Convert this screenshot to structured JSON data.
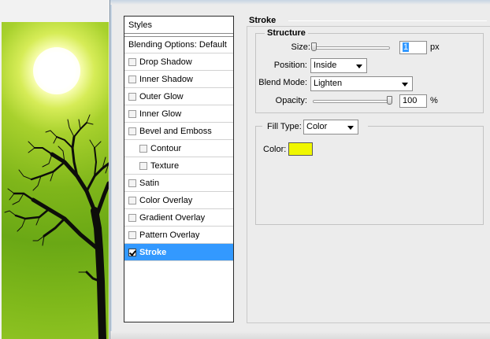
{
  "styles_panel": {
    "header": "Styles",
    "blending_options": "Blending Options: Default",
    "items": [
      {
        "label": "Drop Shadow",
        "checked": false,
        "selected": false
      },
      {
        "label": "Inner Shadow",
        "checked": false,
        "selected": false
      },
      {
        "label": "Outer Glow",
        "checked": false,
        "selected": false
      },
      {
        "label": "Inner Glow",
        "checked": false,
        "selected": false
      },
      {
        "label": "Bevel and Emboss",
        "checked": false,
        "selected": false
      },
      {
        "label": "Contour",
        "checked": false,
        "selected": false
      },
      {
        "label": "Texture",
        "checked": false,
        "selected": false
      },
      {
        "label": "Satin",
        "checked": false,
        "selected": false
      },
      {
        "label": "Color Overlay",
        "checked": false,
        "selected": false
      },
      {
        "label": "Gradient Overlay",
        "checked": false,
        "selected": false
      },
      {
        "label": "Pattern Overlay",
        "checked": false,
        "selected": false
      },
      {
        "label": "Stroke",
        "checked": true,
        "selected": true
      }
    ]
  },
  "stroke": {
    "title": "Stroke",
    "structure": {
      "title": "Structure",
      "size_label": "Size:",
      "size_value": "1",
      "size_unit": "px",
      "size_slider_min": 1,
      "size_slider_max": 250,
      "position_label": "Position:",
      "position_value": "Inside",
      "blend_mode_label": "Blend Mode:",
      "blend_mode_value": "Lighten",
      "opacity_label": "Opacity:",
      "opacity_value": "100",
      "opacity_unit": "%"
    },
    "fill": {
      "fill_type_label": "Fill Type:",
      "fill_type_value": "Color",
      "color_label": "Color:",
      "color_value": "#f0f700"
    }
  },
  "colors": {
    "selection": "#3399ff",
    "dialog_bg": "#ececec"
  }
}
